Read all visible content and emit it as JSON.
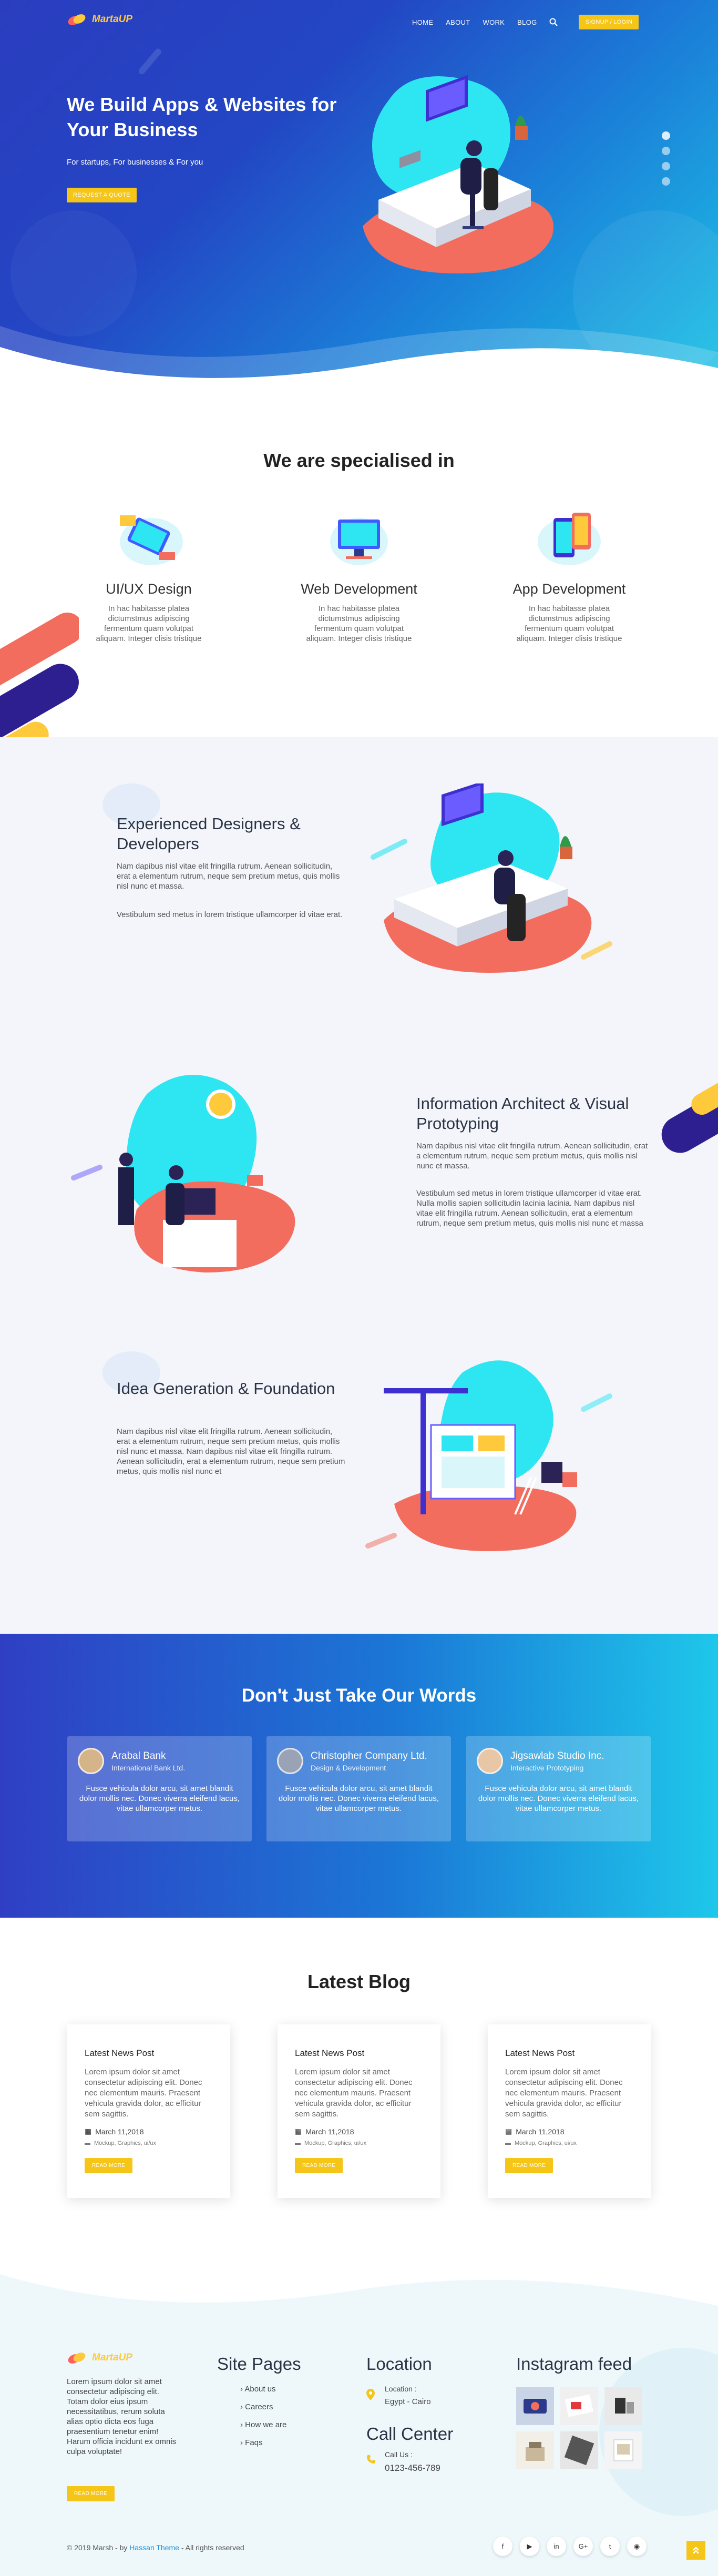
{
  "brand": {
    "name": "MartaUP",
    "colors": {
      "primary": "#2346c4",
      "accent": "#f5c518",
      "cyan": "#1ec3e6",
      "coral": "#f26d5e"
    }
  },
  "nav": {
    "items": [
      "HOME",
      "ABOUT",
      "WORK",
      "BLOG"
    ],
    "search_icon": "search-icon",
    "cta": "SIGNUP / LOGIN"
  },
  "hero": {
    "title": "We Build Apps & Websites for Your Business",
    "subtitle": "For startups, For businesses & For you",
    "cta": "REQUEST A QUOTE",
    "slider_dots": 4
  },
  "services": {
    "title": "We are specialised in",
    "items": [
      {
        "title": "UI/UX Design",
        "text": "In hac habitasse platea dictumstmus adipiscing fermentum quam volutpat aliquam. Integer clisis tristique"
      },
      {
        "title": "Web Development",
        "text": "In hac habitasse platea dictumstmus adipiscing fermentum quam volutpat aliquam. Integer clisis tristique"
      },
      {
        "title": "App Development",
        "text": "In hac habitasse platea dictumstmus adipiscing fermentum quam volutpat aliquam. Integer clisis tristique"
      }
    ]
  },
  "features": [
    {
      "title": "Experienced Designers & Developers",
      "p1": "Nam dapibus nisl vitae elit fringilla rutrum. Aenean sollicitudin, erat a elementum rutrum, neque sem pretium metus, quis mollis nisl nunc et massa.",
      "p2": "Vestibulum sed metus in lorem tristique ullamcorper id vitae erat."
    },
    {
      "title": "Information Architect & Visual Prototyping",
      "p1": "Nam dapibus nisl vitae elit fringilla rutrum. Aenean sollicitudin, erat a elementum rutrum, neque sem pretium metus, quis mollis nisl nunc et massa.",
      "p2": "Vestibulum sed metus in lorem tristique ullamcorper id vitae erat. Nulla mollis sapien sollicitudin lacinia lacinia. Nam dapibus nisl vitae elit fringilla rutrum. Aenean sollicitudin, erat a elementum rutrum, neque sem pretium metus, quis mollis nisl nunc et massa"
    },
    {
      "title": "Idea Generation & Foundation",
      "p1": "Nam dapibus nisl vitae elit fringilla rutrum. Aenean sollicitudin, erat a elementum rutrum, neque sem pretium metus, quis mollis nisl nunc et massa. Nam dapibus nisl vitae elit fringilla rutrum. Aenean sollicitudin, erat a elementum rutrum, neque sem pretium metus, quis mollis nisl nunc et",
      "p2": ""
    }
  ],
  "testimonials": {
    "title": "Don't Just Take Our Words",
    "items": [
      {
        "name": "Arabal Bank",
        "role": "International Bank Ltd.",
        "text": "Fusce vehicula dolor arcu, sit amet blandit dolor mollis nec. Donec viverra eleifend lacus, vitae ullamcorper metus."
      },
      {
        "name": "Christopher Company Ltd.",
        "role": "Design & Development",
        "text": "Fusce vehicula dolor arcu, sit amet blandit dolor mollis nec. Donec viverra eleifend lacus, vitae ullamcorper metus."
      },
      {
        "name": "Jigsawlab Studio Inc.",
        "role": "Interactive Prototyping",
        "text": "Fusce vehicula dolor arcu, sit amet blandit dolor mollis nec. Donec viverra eleifend lacus, vitae ullamcorper metus."
      }
    ]
  },
  "blog": {
    "title": "Latest Blog",
    "posts": [
      {
        "title": "Latest News Post",
        "text": "Lorem ipsum dolor sit amet consectetur adipiscing elit. Donec nec elementum mauris. Praesent vehicula gravida dolor, ac efficitur sem sagittis.",
        "date": "March 11,2018",
        "tags": "Mockup, Graphics, ui/ux",
        "cta": "READ MORE"
      },
      {
        "title": "Latest News Post",
        "text": "Lorem ipsum dolor sit amet consectetur adipiscing elit. Donec nec elementum mauris. Praesent vehicula gravida dolor, ac efficitur sem sagittis.",
        "date": "March 11,2018",
        "tags": "Mockup, Graphics, ui/ux",
        "cta": "READ MORE"
      },
      {
        "title": "Latest News Post",
        "text": "Lorem ipsum dolor sit amet consectetur adipiscing elit. Donec nec elementum mauris. Praesent vehicula gravida dolor, ac efficitur sem sagittis.",
        "date": "March 11,2018",
        "tags": "Mockup, Graphics, ui/ux",
        "cta": "READ MORE"
      }
    ]
  },
  "footer": {
    "about": "Lorem ipsum dolor sit amet consectetur adipiscing elit. Totam dolor eius ipsum necessitatibus, rerum soluta alias optio dicta eos fuga praesentium tenetur enim! Harum officia incidunt ex omnis culpa voluptate!",
    "about_cta": "READ MORE",
    "site_pages_title": "Site Pages",
    "site_pages": [
      "About us",
      "Careers",
      "How we are",
      "Faqs"
    ],
    "location_title": "Location",
    "location_label": "Location :",
    "location_value": "Egypt - Cairo",
    "call_title": "Call Center",
    "call_label": "Call Us :",
    "call_value": "0123-456-789",
    "instagram_title": "Instagram feed",
    "copyright_prefix": "© 2019 Marsh - by ",
    "copyright_link": "Hassan Theme",
    "copyright_suffix": " - All rights reserved",
    "social": [
      "f",
      "▶",
      "in",
      "G+",
      "t",
      "◉"
    ]
  }
}
